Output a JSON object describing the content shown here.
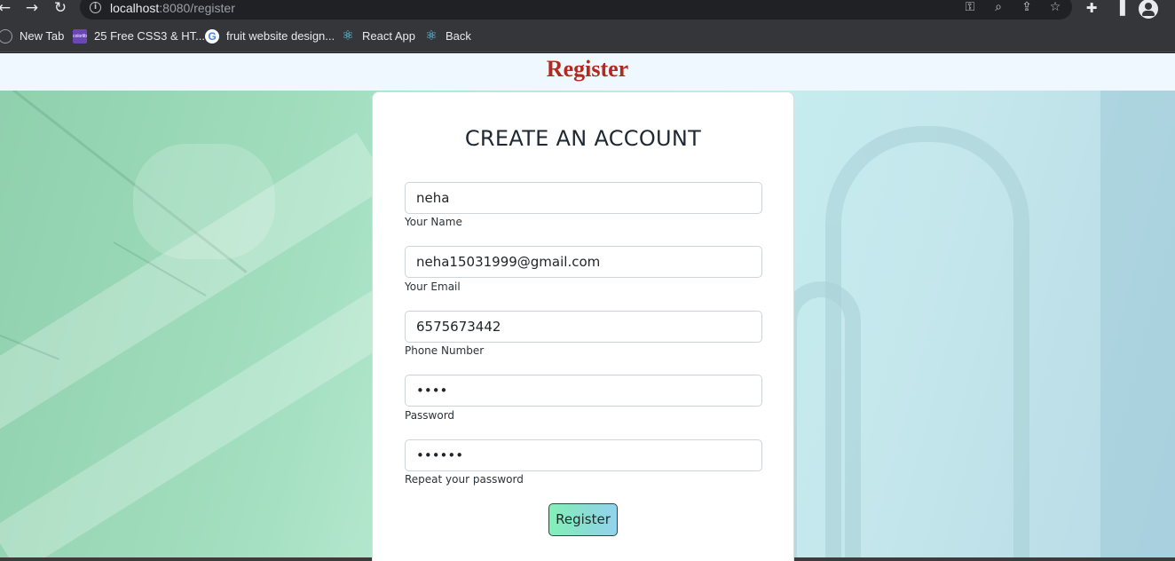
{
  "browser": {
    "url_host": "localhost",
    "url_path": ":8080/register",
    "bookmarks": [
      {
        "label": "New Tab",
        "icon": "globe-icon"
      },
      {
        "label": "25 Free CSS3 & HT...",
        "icon": "colorlib-icon"
      },
      {
        "label": "fruit website design...",
        "icon": "google-icon"
      },
      {
        "label": "React App",
        "icon": "react-icon"
      },
      {
        "label": "Back",
        "icon": "react-icon"
      }
    ]
  },
  "header": {
    "title": "Register"
  },
  "form": {
    "title": "CREATE AN ACCOUNT",
    "fields": [
      {
        "value": "neha",
        "label": "Your Name",
        "type": "text"
      },
      {
        "value": "neha15031999@gmail.com",
        "label": "Your Email",
        "type": "email"
      },
      {
        "value": "6575673442",
        "label": "Phone Number",
        "type": "text"
      },
      {
        "value": "••••",
        "label": "Password",
        "type": "password"
      },
      {
        "value": "••••••",
        "label": "Repeat your password",
        "type": "password"
      }
    ],
    "submit_label": "Register"
  }
}
